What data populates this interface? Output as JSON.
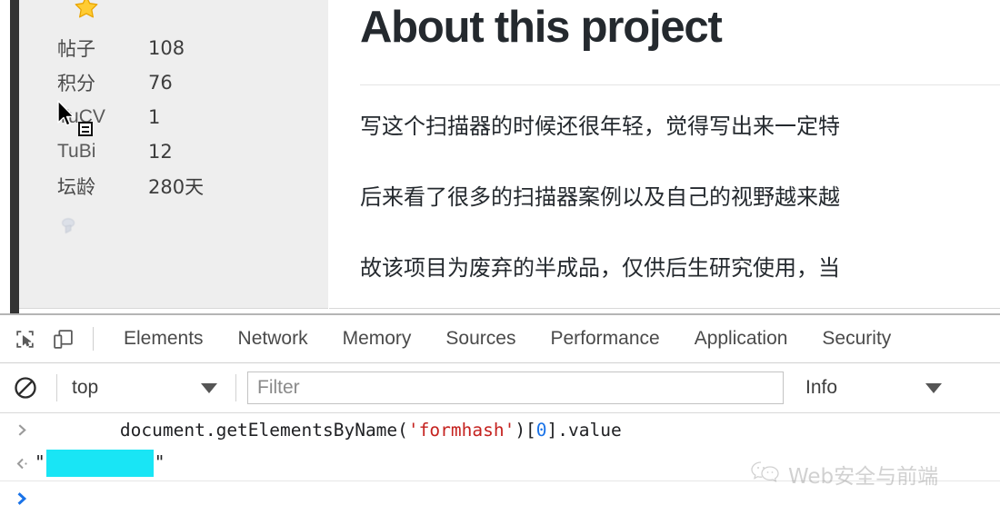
{
  "profile": {
    "badge_icon": "star-icon",
    "medal_icon": "medal-icon",
    "stats": [
      {
        "label": "帖子",
        "value": "108",
        "latin": false
      },
      {
        "label": "积分",
        "value": "76",
        "latin": false
      },
      {
        "label": "TuCV",
        "value": "1",
        "latin": true
      },
      {
        "label": "TuBi",
        "value": "12",
        "latin": true
      },
      {
        "label": "坛龄",
        "value": "280天",
        "latin": false
      }
    ]
  },
  "article": {
    "title": "About this project",
    "paragraphs": [
      "写这个扫描器的时候还很年轻，觉得写出来一定特",
      "后来看了很多的扫描器案例以及自己的视野越来越",
      "故该项目为废弃的半成品，仅供后生研究使用，当"
    ]
  },
  "devtools": {
    "toolbar": {
      "inspect_icon": "inspect-element-icon",
      "device_icon": "device-toolbar-icon",
      "tabs": [
        {
          "label": "Elements"
        },
        {
          "label": "Network"
        },
        {
          "label": "Memory"
        },
        {
          "label": "Sources"
        },
        {
          "label": "Performance"
        },
        {
          "label": "Application"
        },
        {
          "label": "Security"
        }
      ]
    },
    "filterbar": {
      "clear_icon": "clear-console-icon",
      "context": "top",
      "context_caret_icon": "chevron-down-icon",
      "filter_placeholder": "Filter",
      "filter_value": "",
      "level": "Info",
      "level_caret_icon": "chevron-down-icon"
    },
    "console": {
      "input_gutter_icon": "chevron-right-icon",
      "result_gutter_icon": "return-arrow-icon",
      "prompt_gutter_icon": "chevron-right-icon",
      "input": {
        "prefix": "document.getElementsByName(",
        "string_literal": "'formhash'",
        "bracket_open": ")[",
        "index": "0",
        "suffix": "].value"
      },
      "result": {
        "quote_open": "\"",
        "redacted": true,
        "quote_close": "\""
      },
      "prompt_value": ""
    }
  },
  "watermark": {
    "icon": "wechat-icon",
    "text": "Web安全与前端"
  },
  "colors": {
    "devtools_border": "#b5b5b5",
    "sidebar_bg": "#eeeeee",
    "rail": "#343434",
    "string_red": "#c5221f",
    "number_blue": "#1a73e8",
    "redaction_cyan": "#19e5f5",
    "star_yellow": "#ffc107"
  }
}
